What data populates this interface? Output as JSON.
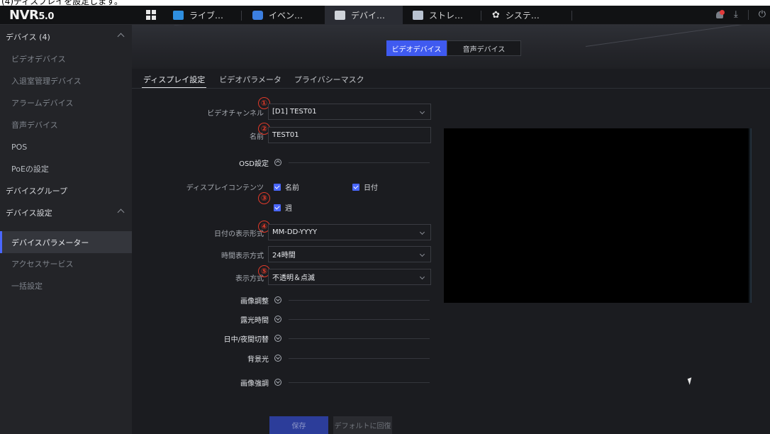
{
  "caption": {
    "text": "(4)ディスプレイを設定します。"
  },
  "app": {
    "logo_main": "NVR",
    "logo_version": "5.0"
  },
  "topbar": {
    "tabs": [
      {
        "label": "ライブ…",
        "icon": "camera-icon",
        "active": false
      },
      {
        "label": "イベン…",
        "icon": "event-icon",
        "active": false
      },
      {
        "label": "デバイ…",
        "icon": "device-icon",
        "active": true
      },
      {
        "label": "ストレ…",
        "icon": "storage-icon",
        "active": false
      },
      {
        "label": "システ…",
        "icon": "gear-icon",
        "active": false
      }
    ],
    "right_icons": [
      "notification-bell-icon",
      "download-icon",
      "power-icon"
    ]
  },
  "sidebar": {
    "items": [
      {
        "label": "デバイス (4)",
        "type": "group",
        "expanded": true
      },
      {
        "label": "ビデオデバイス",
        "type": "sub"
      },
      {
        "label": "入退室管理デバイス",
        "type": "sub"
      },
      {
        "label": "アラームデバイス",
        "type": "sub"
      },
      {
        "label": "音声デバイス",
        "type": "sub"
      },
      {
        "label": "POS",
        "type": "sub-bright"
      },
      {
        "label": "PoEの設定",
        "type": "sub-bright"
      },
      {
        "label": "デバイスグループ",
        "type": "group"
      },
      {
        "label": "デバイス設定",
        "type": "group",
        "expanded": true
      },
      {
        "label": "デバイスパラメーター",
        "type": "sub",
        "active": true
      },
      {
        "label": "アクセスサービス",
        "type": "sub"
      },
      {
        "label": "一括設定",
        "type": "sub"
      }
    ]
  },
  "segment": {
    "video_label": "ビデオデバイス",
    "audio_label": "音声デバイス"
  },
  "subtabs": [
    {
      "label": "ディスプレイ設定",
      "active": true
    },
    {
      "label": "ビデオパラメータ",
      "active": false
    },
    {
      "label": "プライバシーマスク",
      "active": false
    }
  ],
  "form": {
    "channel": {
      "label": "ビデオチャンネル",
      "value": "[D1] TEST01",
      "badge": "①"
    },
    "name": {
      "label": "名前",
      "value": "TEST01",
      "badge": "②"
    },
    "osd": {
      "label": "OSD設定"
    },
    "display_content": {
      "label": "ディスプレイコンテンツ",
      "badge": "③",
      "options": [
        {
          "label": "名前",
          "checked": true
        },
        {
          "label": "日付",
          "checked": true
        },
        {
          "label": "週",
          "checked": true
        }
      ]
    },
    "date_format": {
      "label": "日付の表示形式",
      "value": "MM-DD-YYYY",
      "badge": "④"
    },
    "time_format": {
      "label": "時間表示方式",
      "value": "24時間"
    },
    "display_mode": {
      "label": "表示方式",
      "value": "不透明＆点滅",
      "badge": "⑤"
    },
    "sections": [
      {
        "label": "画像調整"
      },
      {
        "label": "露光時間"
      },
      {
        "label": "日中/夜間切替"
      },
      {
        "label": "背景光"
      },
      {
        "label": "画像強調"
      }
    ]
  },
  "buttons": {
    "save": "保存",
    "restore_default": "デフォルトに回復"
  },
  "colors": {
    "accent": "#4a67ff",
    "badge_red": "#e03a2a",
    "background": "#1b1c20",
    "sidebar": "#232428"
  }
}
